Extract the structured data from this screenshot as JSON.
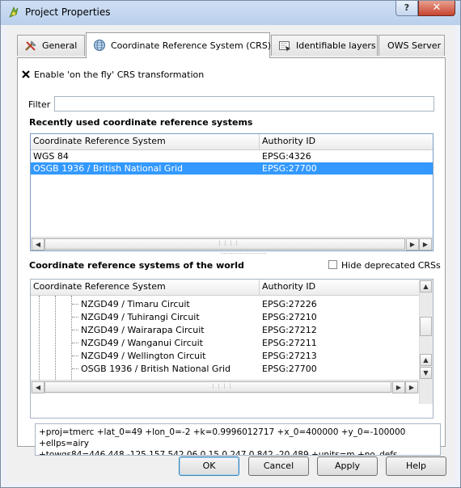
{
  "window": {
    "title": "Project Properties",
    "help_label": "?",
    "close_label": "✕"
  },
  "tabs": [
    {
      "label": "General",
      "icon": "tools-icon"
    },
    {
      "label": "Coordinate Reference System (CRS)",
      "icon": "globe-icon"
    },
    {
      "label": "Identifiable layers",
      "icon": "identify-icon"
    },
    {
      "label": "OWS Server"
    }
  ],
  "crs": {
    "otf_label": "Enable 'on the fly' CRS transformation",
    "otf_checked": true,
    "filter_label": "Filter",
    "filter_value": "",
    "recent_title": "Recently used coordinate reference systems",
    "recent_columns": [
      "Coordinate Reference System",
      "Authority ID"
    ],
    "recent_rows": [
      {
        "name": "WGS 84",
        "auth": "EPSG:4326",
        "selected": false
      },
      {
        "name": "OSGB 1936 / British National Grid",
        "auth": "EPSG:27700",
        "selected": true
      }
    ],
    "world_title": "Coordinate reference systems of the world",
    "hide_deprecated_label": "Hide deprecated CRSs",
    "hide_deprecated_checked": false,
    "world_columns": [
      "Coordinate Reference System",
      "Authority ID"
    ],
    "world_rows": [
      {
        "name": "NZGD49 / Timaru Circuit",
        "auth": "EPSG:27226"
      },
      {
        "name": "NZGD49 / Tuhirangi Circuit",
        "auth": "EPSG:27210"
      },
      {
        "name": "NZGD49 / Wairarapa Circuit",
        "auth": "EPSG:27212"
      },
      {
        "name": "NZGD49 / Wanganui Circuit",
        "auth": "EPSG:27211"
      },
      {
        "name": "NZGD49 / Wellington Circuit",
        "auth": "EPSG:27213"
      },
      {
        "name": "OSGB 1936 / British National Grid",
        "auth": "EPSG:27700"
      }
    ],
    "proj_line1": "+proj=tmerc +lat_0=49 +lon_0=-2 +k=0.9996012717 +x_0=400000 +y_0=-100000 +ellps=airy",
    "proj_line2": "+towgs84=446.448,-125.157,542.06,0.15,0.247,0.842,-20.489 +units=m +no_defs"
  },
  "buttons": {
    "ok": "OK",
    "cancel": "Cancel",
    "apply": "Apply",
    "help": "Help"
  }
}
